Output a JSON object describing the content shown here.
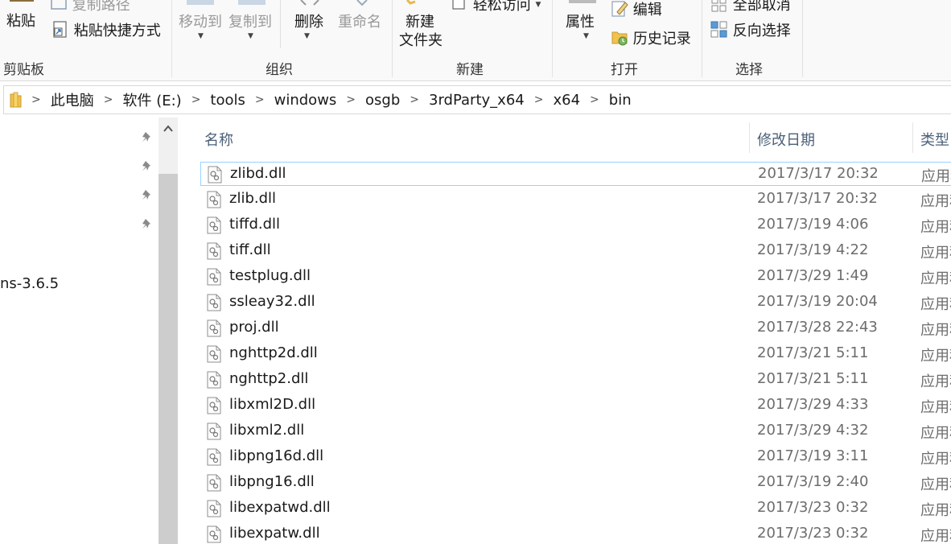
{
  "ribbon": {
    "clipboard": {
      "paste_label": "粘贴",
      "copy_path_label": "复制路径",
      "paste_shortcut_label": "粘贴快捷方式",
      "group_label": "剪贴板"
    },
    "organize": {
      "move_to_label": "移动到",
      "copy_to_label": "复制到",
      "delete_label": "删除",
      "rename_label": "重命名",
      "group_label": "组织"
    },
    "new": {
      "new_folder_line1": "新建",
      "new_folder_line2": "文件夹",
      "easy_access_label": "轻松访问",
      "group_label": "新建"
    },
    "open": {
      "properties_label": "属性",
      "edit_label": "编辑",
      "history_label": "历史记录",
      "group_label": "打开"
    },
    "select": {
      "select_none_label": "全部取消",
      "invert_selection_label": "反向选择",
      "group_label": "选择"
    }
  },
  "address_bar": {
    "crumbs": [
      "此电脑",
      "软件 (E:)",
      "tools",
      "windows",
      "osgb",
      "3rdParty_x64",
      "x64",
      "bin"
    ]
  },
  "nav_pane": {
    "visible_item_text": "ns-3.6.5"
  },
  "file_list": {
    "columns": {
      "name": "名称",
      "date": "修改日期",
      "type": "类型"
    },
    "type_text": "应用程序扩展",
    "files": [
      {
        "name": "zlibd.dll",
        "date": "2017/3/17 20:32",
        "selected": true
      },
      {
        "name": "zlib.dll",
        "date": "2017/3/17 20:32"
      },
      {
        "name": "tiffd.dll",
        "date": "2017/3/19 4:06"
      },
      {
        "name": "tiff.dll",
        "date": "2017/3/19 4:22"
      },
      {
        "name": "testplug.dll",
        "date": "2017/3/29 1:49"
      },
      {
        "name": "ssleay32.dll",
        "date": "2017/3/19 20:04"
      },
      {
        "name": "proj.dll",
        "date": "2017/3/28 22:43"
      },
      {
        "name": "nghttp2d.dll",
        "date": "2017/3/21 5:11"
      },
      {
        "name": "nghttp2.dll",
        "date": "2017/3/21 5:11"
      },
      {
        "name": "libxml2D.dll",
        "date": "2017/3/29 4:33"
      },
      {
        "name": "libxml2.dll",
        "date": "2017/3/29 4:32"
      },
      {
        "name": "libpng16d.dll",
        "date": "2017/3/19 3:11"
      },
      {
        "name": "libpng16.dll",
        "date": "2017/3/19 2:40"
      },
      {
        "name": "libexpatwd.dll",
        "date": "2017/3/23 0:32"
      },
      {
        "name": "libexpatw.dll",
        "date": "2017/3/23 0:32"
      }
    ]
  }
}
